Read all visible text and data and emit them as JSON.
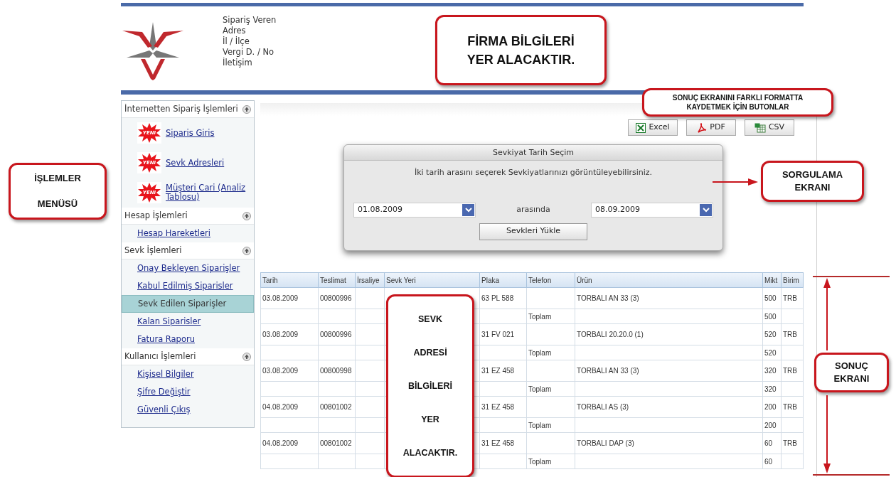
{
  "header": {
    "info_lines": [
      "Sipariş Veren",
      "Adres",
      "İl / İlçe",
      "Vergi D. / No",
      "İletişim"
    ]
  },
  "sidebar": {
    "sections": [
      {
        "title": "İnternetten Sipariş İşlemleri",
        "items": [
          {
            "label": "Siparis Giris",
            "badge": "YENI",
            "selected": false
          },
          {
            "label": "Sevk Adresleri",
            "badge": "YENI",
            "selected": false
          },
          {
            "label": "Müşteri Cari (Analiz Tablosu)",
            "badge": "YENI",
            "selected": false
          }
        ]
      },
      {
        "title": "Hesap İşlemleri",
        "items": [
          {
            "label": "Hesap Hareketleri",
            "selected": false
          }
        ]
      },
      {
        "title": "Sevk İşlemleri",
        "items": [
          {
            "label": "Onay Bekleyen Siparişler",
            "selected": false
          },
          {
            "label": "Kabul Edilmiş Siparisler",
            "selected": false
          },
          {
            "label": "Sevk Edilen Siparişler",
            "selected": true
          },
          {
            "label": "Kalan Siparisler",
            "selected": false
          },
          {
            "label": "Fatura Raporu",
            "selected": false
          }
        ]
      },
      {
        "title": "Kullanıcı İşlemleri",
        "items": [
          {
            "label": "Kişisel Bilgiler",
            "selected": false
          },
          {
            "label": "Şifre Değiştir",
            "selected": false
          },
          {
            "label": "Güvenli Çıkış",
            "selected": false
          }
        ]
      }
    ]
  },
  "export_buttons": [
    {
      "kind": "excel",
      "label": "Excel"
    },
    {
      "kind": "pdf",
      "label": "PDF"
    },
    {
      "kind": "csv",
      "label": "CSV"
    }
  ],
  "dialog": {
    "title": "Sevkiyat Tarih Seçim",
    "hint": "İki tarih arasını seçerek Sevkiyatlarınızı görüntüleyebilirsiniz.",
    "from_date": "01.08.2009",
    "between": "arasında",
    "to_date": "08.09.2009",
    "button": "Sevkleri Yükle"
  },
  "table": {
    "columns": [
      "Tarih",
      "Teslimat",
      "İrsaliye",
      "Sevk Yeri",
      "Plaka",
      "Telefon",
      "Ürün",
      "Mikt",
      "Birim"
    ],
    "rows": [
      {
        "kind": "data",
        "cells": [
          "03.08.2009",
          "00800996",
          "",
          "",
          "63 PL 588",
          "",
          "TORBALI AN 33 (3)",
          "500",
          "TRB"
        ]
      },
      {
        "kind": "total",
        "cells": [
          "",
          "",
          "",
          "",
          "",
          "Toplam",
          "",
          "500",
          ""
        ]
      },
      {
        "kind": "data",
        "cells": [
          "03.08.2009",
          "00800996",
          "",
          "",
          "31 FV 021",
          "",
          "TORBALI 20.20.0 (1)",
          "520",
          "TRB"
        ]
      },
      {
        "kind": "total",
        "cells": [
          "",
          "",
          "",
          "",
          "",
          "Toplam",
          "",
          "520",
          ""
        ]
      },
      {
        "kind": "data",
        "cells": [
          "03.08.2009",
          "00800998",
          "",
          "",
          "31 EZ 458",
          "",
          "TORBALI AN 33 (3)",
          "320",
          "TRB"
        ]
      },
      {
        "kind": "total",
        "cells": [
          "",
          "",
          "",
          "",
          "",
          "Toplam",
          "",
          "320",
          ""
        ]
      },
      {
        "kind": "data",
        "cells": [
          "04.08.2009",
          "00801002",
          "",
          "",
          "31 EZ 458",
          "",
          "TORBALI AS (3)",
          "200",
          "TRB"
        ]
      },
      {
        "kind": "total",
        "cells": [
          "",
          "",
          "",
          "",
          "",
          "Toplam",
          "",
          "200",
          ""
        ]
      },
      {
        "kind": "data",
        "cells": [
          "04.08.2009",
          "00801002",
          "",
          "",
          "31 EZ 458",
          "",
          "TORBALI DAP (3)",
          "60",
          "TRB"
        ]
      },
      {
        "kind": "total",
        "cells": [
          "",
          "",
          "",
          "",
          "",
          "Toplam",
          "",
          "60",
          ""
        ]
      }
    ]
  },
  "callouts": [
    {
      "kind": "firm",
      "lines": [
        "FİRMA BİLGİLERİ",
        "YER ALACAKTIR."
      ]
    },
    {
      "kind": "export",
      "lines": [
        "SONUÇ EKRANINI FARKLI FORMATTA",
        "KAYDETMEK İÇİN BUTONLAR"
      ]
    },
    {
      "kind": "menu",
      "lines": [
        "İŞLEMLER",
        "MENÜSÜ"
      ]
    },
    {
      "kind": "query",
      "lines": [
        "SORGULAMA",
        "EKRANI"
      ]
    },
    {
      "kind": "address",
      "lines": [
        "SEVK",
        "ADRESİ",
        "BİLGİLERİ",
        "YER",
        "ALACAKTIR."
      ]
    },
    {
      "kind": "result",
      "lines": [
        "SONUÇ",
        "EKRANI"
      ]
    }
  ]
}
